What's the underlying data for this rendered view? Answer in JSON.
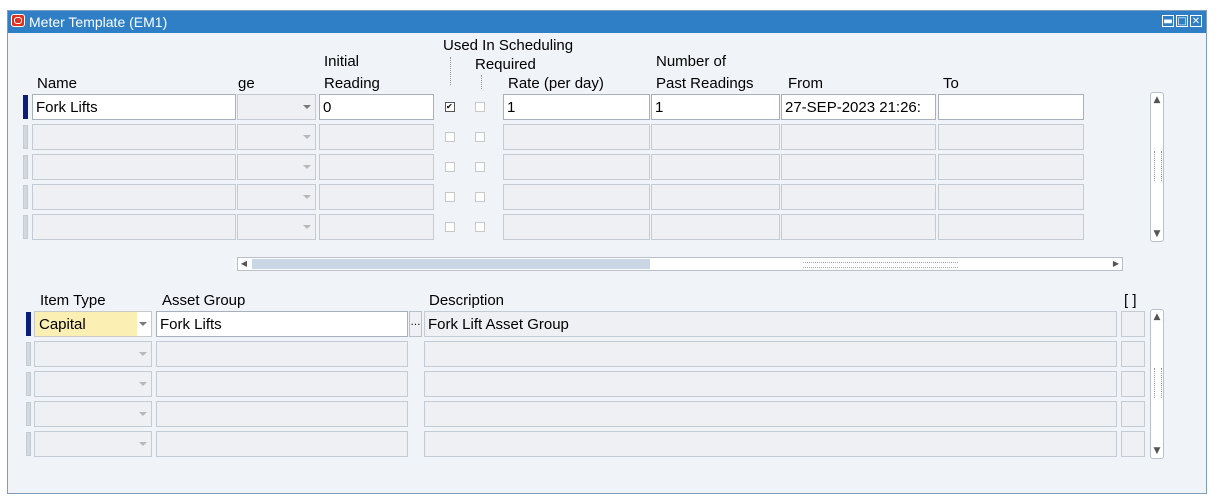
{
  "window": {
    "title": "Meter Template (EM1)",
    "minimize_glyph": "▬",
    "maximize_glyph": "□",
    "close_glyph": "✕"
  },
  "meter_block": {
    "headers": {
      "name": "Name",
      "usage_partial": "ge",
      "initial_line1": "Initial",
      "initial_line2": "Reading",
      "used_in_scheduling": "Used In Scheduling",
      "required": "Required",
      "rate": "Rate (per day)",
      "num_line1": "Number of",
      "num_line2": "Past Readings",
      "from": "From",
      "to": "To"
    },
    "rows": [
      {
        "name": "Fork Lifts",
        "initial": "0",
        "used_in_scheduling": true,
        "required": false,
        "rate": "1",
        "past_readings": "1",
        "from": "27-SEP-2023 21:26:",
        "to": ""
      },
      {
        "name": "",
        "initial": "",
        "used_in_scheduling": false,
        "required": false,
        "rate": "",
        "past_readings": "",
        "from": "",
        "to": ""
      },
      {
        "name": "",
        "initial": "",
        "used_in_scheduling": false,
        "required": false,
        "rate": "",
        "past_readings": "",
        "from": "",
        "to": ""
      },
      {
        "name": "",
        "initial": "",
        "used_in_scheduling": false,
        "required": false,
        "rate": "",
        "past_readings": "",
        "from": "",
        "to": ""
      },
      {
        "name": "",
        "initial": "",
        "used_in_scheduling": false,
        "required": false,
        "rate": "",
        "past_readings": "",
        "from": "",
        "to": ""
      }
    ]
  },
  "asset_block": {
    "headers": {
      "item_type": "Item Type",
      "asset_group": "Asset Group",
      "description": "Description",
      "flex": "[ ]"
    },
    "lov_glyph": "…",
    "rows": [
      {
        "item_type": "Capital",
        "asset_group": "Fork Lifts",
        "description": "Fork Lift Asset Group"
      },
      {
        "item_type": "",
        "asset_group": "",
        "description": ""
      },
      {
        "item_type": "",
        "asset_group": "",
        "description": ""
      },
      {
        "item_type": "",
        "asset_group": "",
        "description": ""
      },
      {
        "item_type": "",
        "asset_group": "",
        "description": ""
      }
    ]
  },
  "scroll": {
    "up_glyph": "▲",
    "down_glyph": "▼",
    "left_glyph": "◀",
    "right_glyph": "▶"
  },
  "colors": {
    "title_bar": "#2f7fc6",
    "current_row_indicator": "#0a1f7a",
    "required_field": "#fcefb4"
  }
}
